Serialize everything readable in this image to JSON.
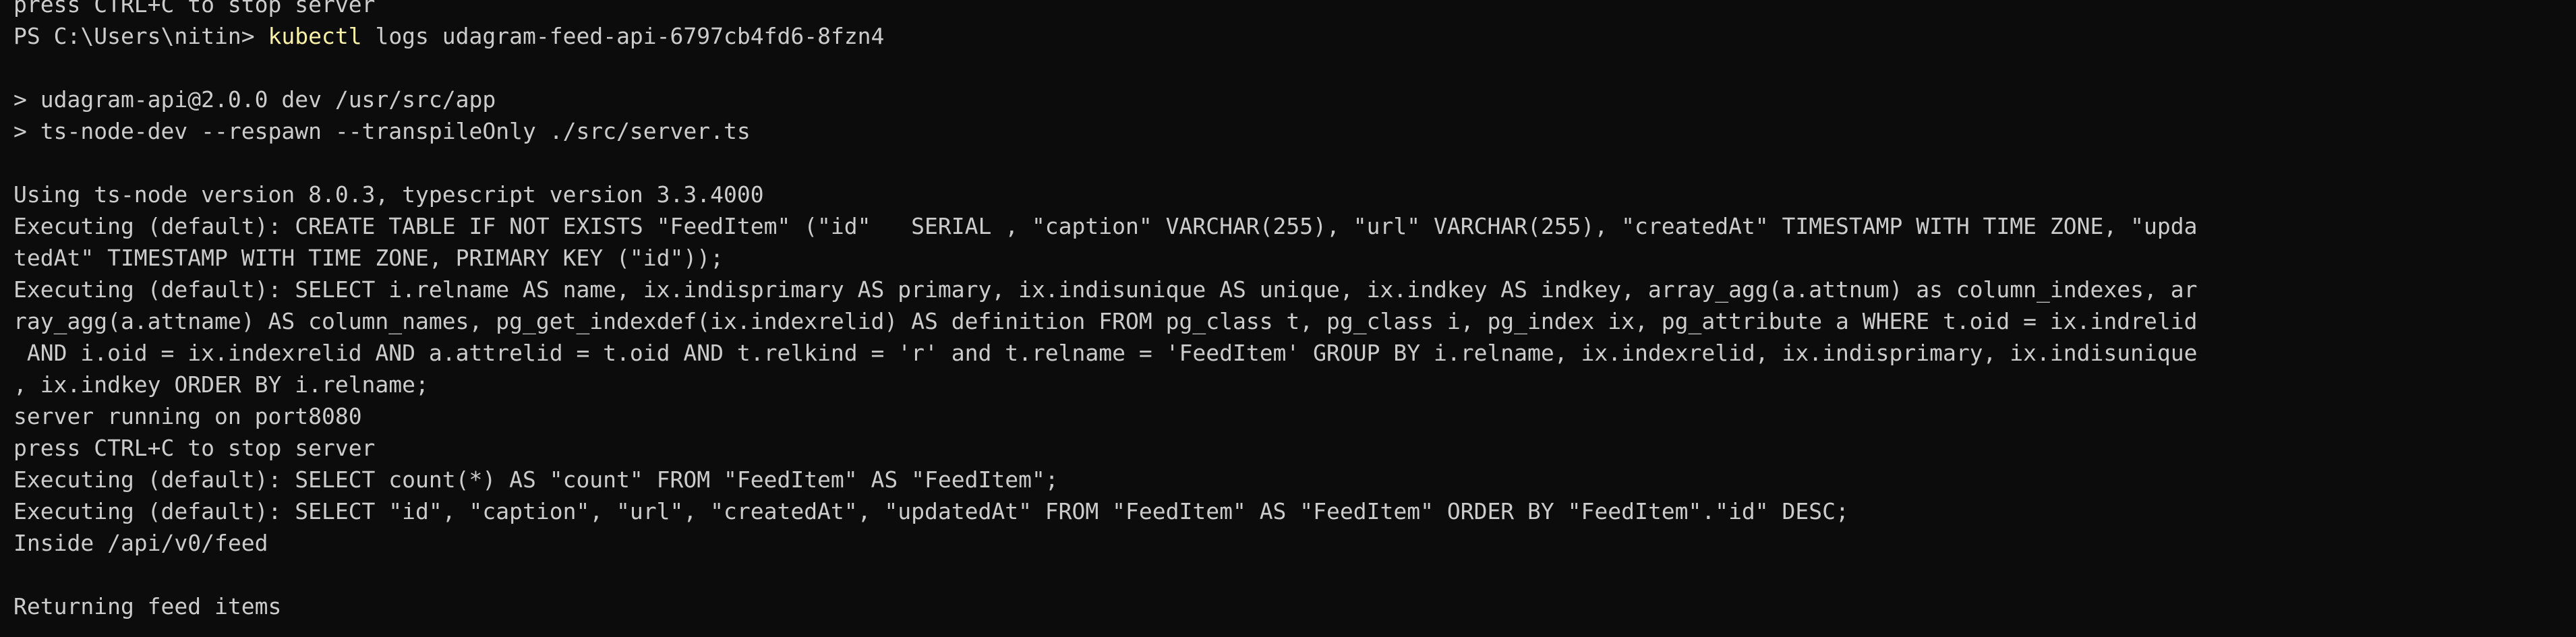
{
  "terminal": {
    "partial_top": "press CTRL+C to stop server",
    "prompt": "PS C:\\Users\\nitin> ",
    "command_name": "kubectl",
    "command_args": " logs udagram-feed-api-6797cb4fd6-8fzn4",
    "lines": [
      "",
      "> udagram-api@2.0.0 dev /usr/src/app",
      "> ts-node-dev --respawn --transpileOnly ./src/server.ts",
      "",
      "Using ts-node version 8.0.3, typescript version 3.3.4000",
      "Executing (default): CREATE TABLE IF NOT EXISTS \"FeedItem\" (\"id\"   SERIAL , \"caption\" VARCHAR(255), \"url\" VARCHAR(255), \"createdAt\" TIMESTAMP WITH TIME ZONE, \"upda",
      "tedAt\" TIMESTAMP WITH TIME ZONE, PRIMARY KEY (\"id\"));",
      "Executing (default): SELECT i.relname AS name, ix.indisprimary AS primary, ix.indisunique AS unique, ix.indkey AS indkey, array_agg(a.attnum) as column_indexes, ar",
      "ray_agg(a.attname) AS column_names, pg_get_indexdef(ix.indexrelid) AS definition FROM pg_class t, pg_class i, pg_index ix, pg_attribute a WHERE t.oid = ix.indrelid",
      " AND i.oid = ix.indexrelid AND a.attrelid = t.oid AND t.relkind = 'r' and t.relname = 'FeedItem' GROUP BY i.relname, ix.indexrelid, ix.indisprimary, ix.indisunique",
      ", ix.indkey ORDER BY i.relname;",
      "server running on port8080",
      "press CTRL+C to stop server",
      "Executing (default): SELECT count(*) AS \"count\" FROM \"FeedItem\" AS \"FeedItem\";",
      "Executing (default): SELECT \"id\", \"caption\", \"url\", \"createdAt\", \"updatedAt\" FROM \"FeedItem\" AS \"FeedItem\" ORDER BY \"FeedItem\".\"id\" DESC;",
      "Inside /api/v0/feed",
      "",
      "Returning feed items"
    ]
  },
  "colors": {
    "background": "#0c0c0c",
    "text": "#cccccc",
    "command_highlight": "#f9f1a5"
  }
}
